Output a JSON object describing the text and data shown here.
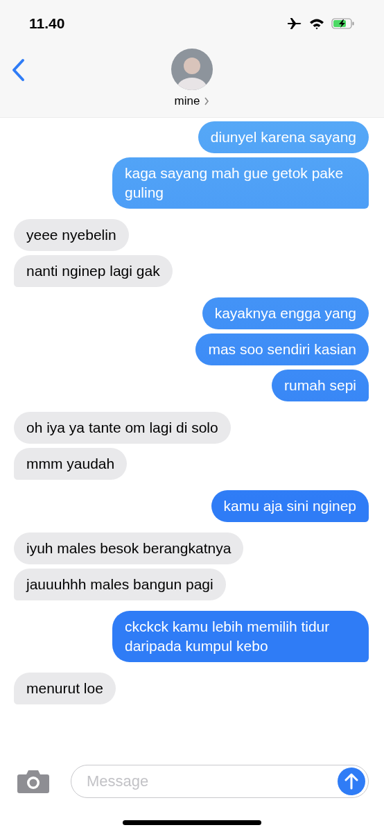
{
  "status_bar": {
    "time": "11.40"
  },
  "header": {
    "contact_name": "mine"
  },
  "messages": [
    {
      "kind": "sent",
      "text": "diunyel karena sayang",
      "tail": false
    },
    {
      "kind": "sent",
      "text": "kaga sayang mah gue getok pake guling",
      "tail": true
    },
    {
      "kind": "received",
      "text": "yeee nyebelin",
      "tail": false
    },
    {
      "kind": "received",
      "text": "nanti nginep lagi gak",
      "tail": true
    },
    {
      "kind": "sent",
      "text": "kayaknya engga yang",
      "tail": false
    },
    {
      "kind": "sent",
      "text": "mas soo sendiri kasian",
      "tail": false
    },
    {
      "kind": "sent",
      "text": "rumah sepi",
      "tail": true
    },
    {
      "kind": "received",
      "text": "oh iya ya tante om lagi di solo",
      "tail": false
    },
    {
      "kind": "received",
      "text": "mmm yaudah",
      "tail": true
    },
    {
      "kind": "sent",
      "text": "kamu aja sini nginep",
      "tail": true
    },
    {
      "kind": "received",
      "text": "iyuh males besok berangkatnya",
      "tail": false
    },
    {
      "kind": "received",
      "text": "jauuuhhh males bangun pagi",
      "tail": true
    },
    {
      "kind": "sent",
      "text": "ckckck kamu lebih memilih tidur daripada kumpul kebo",
      "tail": true
    },
    {
      "kind": "received",
      "text": "menurut loe",
      "tail": true
    }
  ],
  "composer": {
    "placeholder": "Message"
  }
}
